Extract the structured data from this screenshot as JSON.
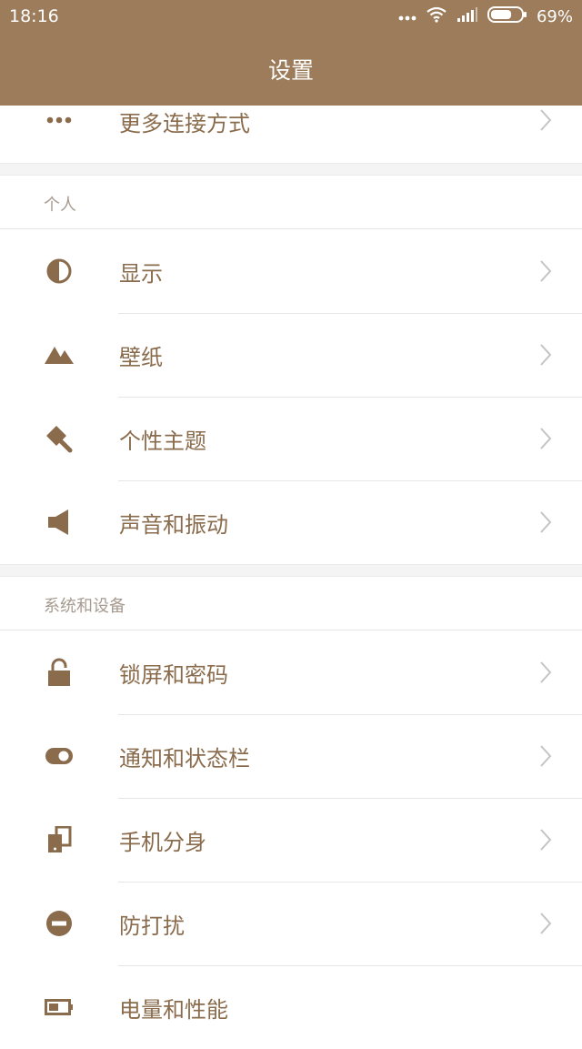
{
  "status_bar": {
    "time": "18:16",
    "battery_percent_text": "69%",
    "battery_level": 0.69,
    "icons": [
      "more-dots-icon",
      "wifi-icon",
      "signal-icon",
      "battery-icon"
    ]
  },
  "app_bar": {
    "title": "设置"
  },
  "colors": {
    "accent": "#9c7c5a",
    "label": "#8a6c4d",
    "icon": "#8a6c4d",
    "header_text": "#a79b90"
  },
  "top_item": {
    "label": "更多连接方式",
    "icon": "more-dots-icon"
  },
  "sections": [
    {
      "header": "个人",
      "items": [
        {
          "label": "显示",
          "icon": "half-circle-icon"
        },
        {
          "label": "壁纸",
          "icon": "mountains-icon"
        },
        {
          "label": "个性主题",
          "icon": "theme-brush-icon"
        },
        {
          "label": "声音和振动",
          "icon": "speaker-icon"
        }
      ]
    },
    {
      "header": "系统和设备",
      "items": [
        {
          "label": "锁屏和密码",
          "icon": "lock-icon"
        },
        {
          "label": "通知和状态栏",
          "icon": "toggle-icon"
        },
        {
          "label": "手机分身",
          "icon": "dual-phone-icon"
        },
        {
          "label": "防打扰",
          "icon": "do-not-disturb-icon"
        },
        {
          "label": "电量和性能",
          "icon": "battery-icon"
        }
      ]
    }
  ]
}
